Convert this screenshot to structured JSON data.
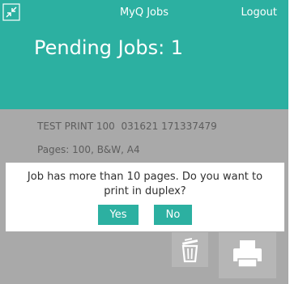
{
  "header": {
    "app_title": "MyQ Jobs",
    "logout_label": "Logout",
    "pending_jobs_title": "Pending Jobs: 1"
  },
  "job": {
    "name": "TEST PRINT 100  031621 171337479",
    "details": "Pages: 100, B&W, A4"
  },
  "dialog": {
    "message": "Job has more than 10 pages. Do you want to print in duplex?",
    "yes_label": "Yes",
    "no_label": "No"
  },
  "icons": {
    "minimize": "minimize-arrows-icon",
    "delete": "trash-icon",
    "print": "printer-icon"
  },
  "colors": {
    "accent": "#2cb0a1",
    "overlay": "#a9a9a9",
    "text_dark": "#2f2f2f",
    "text_muted": "#5d5d5d",
    "white": "#ffffff"
  }
}
